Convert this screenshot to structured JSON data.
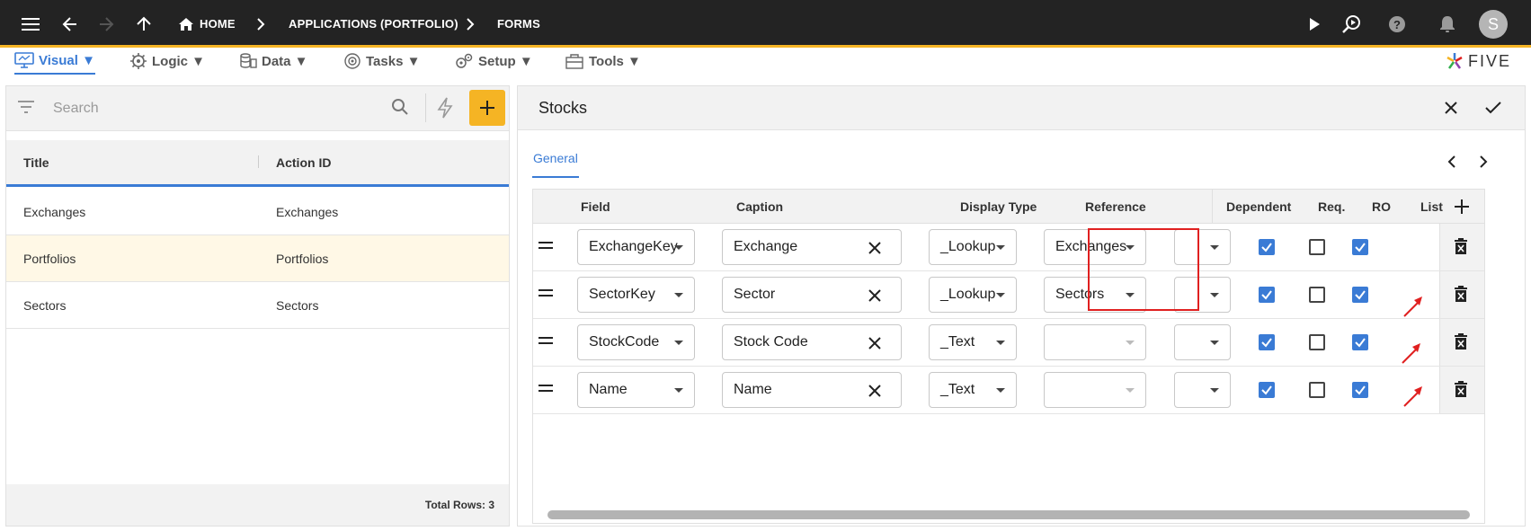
{
  "topbar": {
    "breadcrumbs": [
      "HOME",
      "APPLICATIONS (PORTFOLIO)",
      "FORMS"
    ],
    "avatar_initial": "S"
  },
  "menu": {
    "items": [
      "Visual ▼",
      "Logic ▼",
      "Data ▼",
      "Tasks ▼",
      "Setup ▼",
      "Tools ▼"
    ],
    "active": "Visual",
    "brand": "FIVE"
  },
  "left": {
    "search_placeholder": "Search",
    "columns": [
      "Title",
      "Action ID"
    ],
    "rows": [
      {
        "title": "Exchanges",
        "action_id": "Exchanges"
      },
      {
        "title": "Portfolios",
        "action_id": "Portfolios",
        "selected": true
      },
      {
        "title": "Sectors",
        "action_id": "Sectors"
      }
    ],
    "total_rows": "Total Rows: 3"
  },
  "form": {
    "title": "Stocks",
    "tab": "General",
    "columns": [
      "Field",
      "Caption",
      "Display Type",
      "Reference",
      "Dependent",
      "Req.",
      "RO",
      "List"
    ],
    "rows": [
      {
        "field": "ExchangeKey",
        "caption": "Exchange",
        "display_type": "_Lookup",
        "reference": "Exchanges",
        "dependent": "",
        "req": true,
        "ro": false,
        "list": true
      },
      {
        "field": "SectorKey",
        "caption": "Sector",
        "display_type": "_Lookup",
        "reference": "Sectors",
        "dependent": "",
        "req": true,
        "ro": false,
        "list": true
      },
      {
        "field": "StockCode",
        "caption": "Stock Code",
        "display_type": "_Text",
        "reference": "",
        "dependent": "",
        "req": true,
        "ro": false,
        "list": true
      },
      {
        "field": "Name",
        "caption": "Name",
        "display_type": "_Text",
        "reference": "",
        "dependent": "",
        "req": true,
        "ro": false,
        "list": true
      }
    ]
  },
  "colors": {
    "topbar": "#232323",
    "accent": "#f5b424",
    "primary": "#3a7bd5",
    "highlight": "#e02020",
    "selected_row": "#fff8e6"
  }
}
